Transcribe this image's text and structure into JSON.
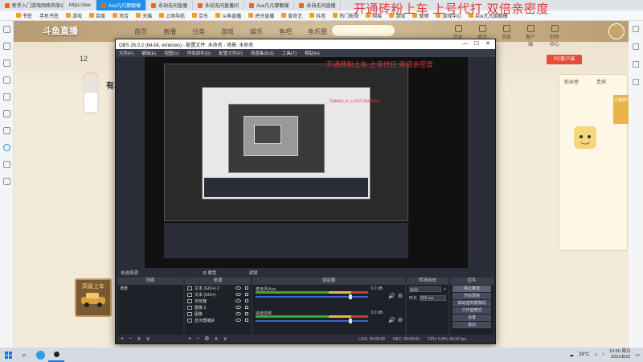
{
  "browser": {
    "tabs": [
      {
        "label": "新手入门游戏网络有限公司",
        "active": false
      },
      {
        "label": "Ace凡凡御靓爆",
        "active": true
      },
      {
        "label": "永劫无间直播",
        "active": false
      },
      {
        "label": "永劫无间直播间",
        "active": false
      },
      {
        "label": "Ace凡凡御靓爆",
        "active": false
      },
      {
        "label": "永劫无间直播",
        "active": false
      }
    ],
    "url_text": "https://ww",
    "bookmarks": [
      "书签",
      "手机书签",
      "游戏",
      "百度",
      "淘宝",
      "天猫",
      "上网导航",
      "京东",
      "斗鱼直播",
      "虎牙直播",
      "爱奇艺",
      "抖音",
      "热门影视",
      "网易",
      "游戏",
      "微博",
      "游戏中心",
      "Ace凡凡御靓爆"
    ]
  },
  "site": {
    "logo": "斗鱼直播",
    "nav": [
      "首页",
      "直播",
      "分类",
      "游戏",
      "娱乐",
      "鱼吧",
      "鱼乐圈"
    ],
    "header_icons": [
      "历史",
      "关注",
      "消息",
      "客户端",
      "创作中心"
    ],
    "room": {
      "fans": "12",
      "name": "有车"
    },
    "promo_card": "高级上车",
    "pc_button": "PC客户端",
    "gift_labels": [
      "粉丝榜",
      "贵宾"
    ],
    "rank_button": "主播排行"
  },
  "obs": {
    "title": "OBS 26.0.2 (64-bit, windows) - 配置文件: 未命名 - 场景: 未命名",
    "menu": [
      "文件(F)",
      "编辑(E)",
      "视图(V)",
      "停靠部件(D)",
      "配置文件(P)",
      "场景集合(S)",
      "工具(T)",
      "帮助(H)"
    ],
    "preview_overlay": "开通砖粉上车 上号代打 双倍亲密度",
    "subheader": {
      "no_source": "未选择源",
      "props": "属性",
      "filters": "滤镜"
    },
    "docks": {
      "scenes": "场景",
      "sources": "来源",
      "mixer": "混音器",
      "transitions": "转场特效",
      "controls": "控件"
    },
    "scene_item": "场景",
    "sources": [
      "文本 (GDI+) 2",
      "文本 (GDI+)",
      "浏览器",
      "图像 3",
      "图像",
      "显示器捕获"
    ],
    "mixer_tracks": [
      {
        "name": "麦克风/Aux",
        "db": "0.0 dB"
      },
      {
        "name": "桌面音频",
        "db": "0.0 dB"
      }
    ],
    "transition": {
      "type": "淡出",
      "duration_label": "时长",
      "duration": "300 ms"
    },
    "controls": [
      "停止推流",
      "开始录制",
      "启动虚拟摄像机",
      "工作室模式",
      "设置",
      "退出"
    ],
    "status": {
      "live": "LIVE: 00:00:00",
      "rec": "REC: 00:00:00",
      "cpu": "CPU: 0.8%, 60.00 fps"
    }
  },
  "top_overlay": "开通砖粉上车 上号代打 双倍亲密度",
  "taskbar": {
    "weather": "28°C",
    "clock_time": "10:50 周日",
    "clock_date": "2021/8/22"
  }
}
